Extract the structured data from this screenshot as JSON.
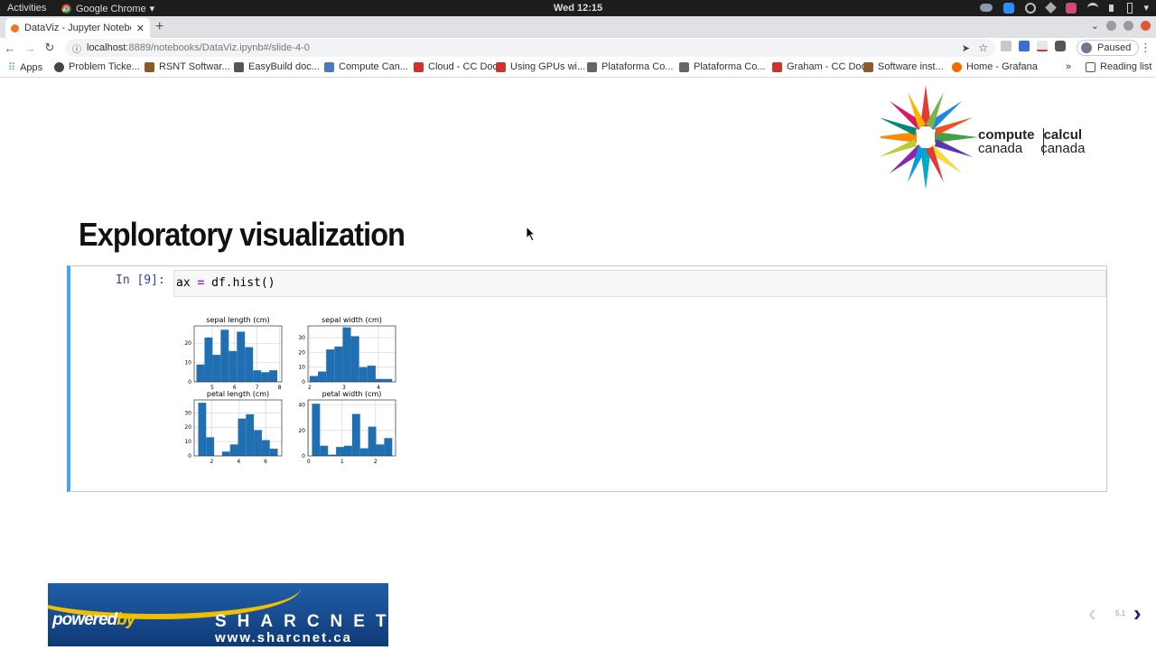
{
  "os": {
    "activities": "Activities",
    "app": "Google Chrome",
    "clock": "Wed 12:15"
  },
  "browser": {
    "tab_title": "DataViz - Jupyter Notebo",
    "url_host": "localhost",
    "url_rest": ":8889/notebooks/DataViz.ipynb#/slide-4-0",
    "profile_status": "Paused",
    "bookmarks": [
      {
        "label": "Apps"
      },
      {
        "label": "Problem Ticke..."
      },
      {
        "label": "RSNT Softwar..."
      },
      {
        "label": "EasyBuild doc..."
      },
      {
        "label": "Compute Can..."
      },
      {
        "label": "Cloud - CC Doc"
      },
      {
        "label": "Using GPUs wi..."
      },
      {
        "label": "Plataforma Co..."
      },
      {
        "label": "Plataforma Co..."
      },
      {
        "label": "Graham - CC Doc"
      },
      {
        "label": "Software inst..."
      },
      {
        "label": "Home - Grafana"
      }
    ],
    "reading_list": "Reading list"
  },
  "slide": {
    "logo_line1_left": "compute",
    "logo_line1_right": "calcul",
    "logo_line2_left": "canada",
    "logo_line2_right": "canada",
    "title": "Exploratory visualization",
    "cell_prompt": "In [9]:",
    "code_var": "ax",
    "code_op": "=",
    "code_rest": "df.hist()",
    "footer_powered": "powered",
    "footer_by": "by",
    "footer_name": "SHARCNET",
    "footer_tm": "™",
    "footer_url": "www.sharcnet.ca",
    "slide_number": "5.1"
  },
  "chart_data": [
    {
      "type": "bar",
      "title": "sepal length (cm)",
      "x_ticks": [
        "5",
        "6",
        "7",
        "8"
      ],
      "y_ticks": [
        "0",
        "10",
        "20"
      ],
      "xlim": [
        4.2,
        8.1
      ],
      "ylim": [
        0,
        29
      ],
      "bins": [
        4.3,
        4.66,
        5.02,
        5.38,
        5.74,
        6.1,
        6.46,
        6.82,
        7.18,
        7.54,
        7.9
      ],
      "values": [
        9,
        23,
        14,
        27,
        16,
        26,
        18,
        6,
        5,
        6
      ],
      "grid": true
    },
    {
      "type": "bar",
      "title": "sepal width (cm)",
      "x_ticks": [
        "2",
        "3",
        "4"
      ],
      "y_ticks": [
        "0",
        "10",
        "20",
        "30"
      ],
      "xlim": [
        1.95,
        4.5
      ],
      "ylim": [
        0,
        38
      ],
      "bins": [
        2.0,
        2.24,
        2.48,
        2.72,
        2.96,
        3.2,
        3.44,
        3.68,
        3.92,
        4.16,
        4.4
      ],
      "values": [
        4,
        7,
        22,
        24,
        37,
        31,
        10,
        11,
        2,
        2
      ],
      "grid": true
    },
    {
      "type": "bar",
      "title": "petal length (cm)",
      "x_ticks": [
        "2",
        "4",
        "6"
      ],
      "y_ticks": [
        "0",
        "10",
        "20",
        "30"
      ],
      "xlim": [
        0.7,
        7.2
      ],
      "ylim": [
        0,
        39
      ],
      "bins": [
        1.0,
        1.59,
        2.18,
        2.77,
        3.36,
        3.95,
        4.54,
        5.13,
        5.72,
        6.31,
        6.9
      ],
      "values": [
        37,
        13,
        0,
        3,
        8,
        26,
        29,
        18,
        11,
        5
      ],
      "grid": true
    },
    {
      "type": "bar",
      "title": "petal width (cm)",
      "x_ticks": [
        "0",
        "1",
        "2"
      ],
      "y_ticks": [
        "0",
        "20",
        "40"
      ],
      "xlim": [
        -0.02,
        2.6
      ],
      "ylim": [
        0,
        44
      ],
      "bins": [
        0.1,
        0.34,
        0.58,
        0.82,
        1.06,
        1.3,
        1.54,
        1.78,
        2.02,
        2.26,
        2.5
      ],
      "values": [
        41,
        8,
        1,
        7,
        8,
        33,
        6,
        23,
        9,
        14
      ],
      "grid": true
    }
  ]
}
